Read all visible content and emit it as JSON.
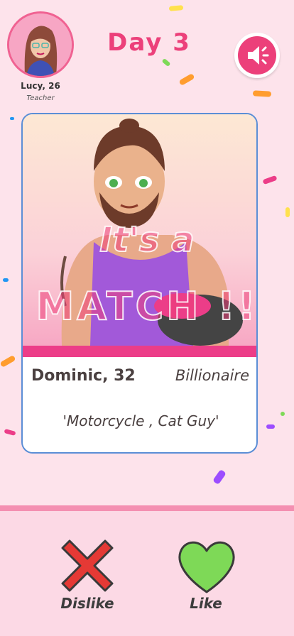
{
  "profile": {
    "name": "Lucy, 26",
    "job": "Teacher"
  },
  "header": {
    "title": "Day 3",
    "sound_icon": "speaker-icon"
  },
  "card": {
    "name": "Dominic, 32",
    "job": "Billionaire",
    "tagline": "'Motorcycle , Cat Guy'"
  },
  "match": {
    "line1": "It's a",
    "line2": "MATCH !!"
  },
  "actions": {
    "dislike": "Dislike",
    "like": "Like"
  },
  "colors": {
    "accent": "#ec407a",
    "card_border": "#5b8ed6",
    "like": "#7ed957",
    "dislike": "#e53935"
  }
}
